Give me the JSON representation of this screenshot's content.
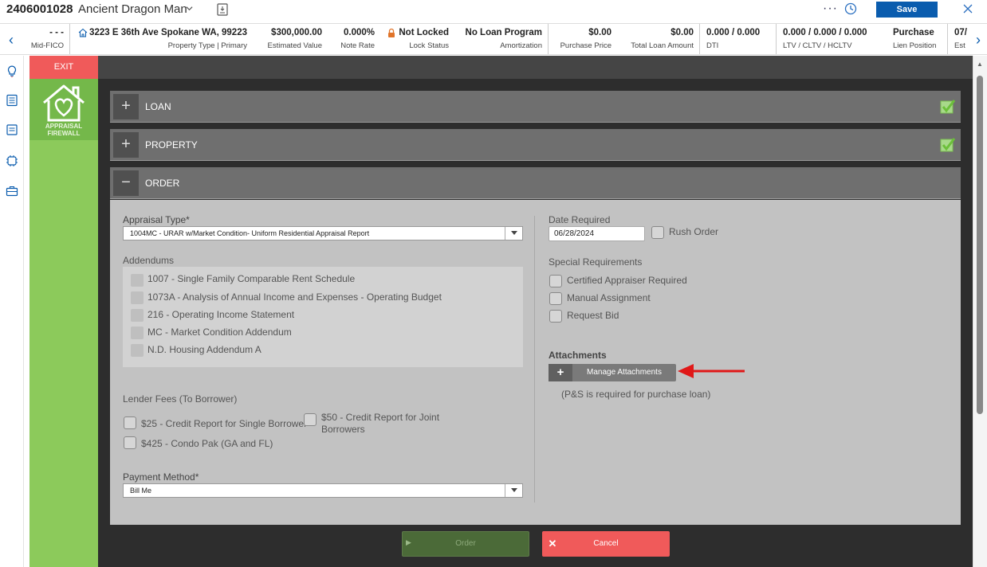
{
  "titlebar": {
    "loan_number": "2406001028",
    "borrower_name": "Ancient Dragon Man",
    "more": "···",
    "save_label": "Save"
  },
  "summary": {
    "items": [
      {
        "value": "- - -",
        "label": "Mid-FICO"
      },
      {
        "value": "3223 E 36th Ave Spokane WA, 99223",
        "label": "Property Type | Primary"
      },
      {
        "value": "$300,000.00",
        "label": "Estimated Value"
      },
      {
        "value": "0.000%",
        "label": "Note Rate"
      },
      {
        "value": "Not Locked",
        "label": "Lock Status"
      },
      {
        "value": "No Loan Program",
        "label": "Amortization"
      },
      {
        "value": "$0.00",
        "label": "Purchase Price"
      },
      {
        "value": "$0.00",
        "label": "Total Loan Amount"
      },
      {
        "value": "0.000 / 0.000",
        "label": "DTI"
      },
      {
        "value": "0.000 / 0.000 / 0.000",
        "label": "LTV / CLTV / HCLTV"
      },
      {
        "value": "Purchase",
        "label": "Lien Position"
      },
      {
        "value": "07/",
        "label": "Est"
      }
    ]
  },
  "sidebar": {
    "exit_label": "EXIT",
    "logo_line1": "APPRAISAL",
    "logo_line2": "FIREWALL"
  },
  "sections": {
    "loan": "LOAN",
    "property": "PROPERTY",
    "order": "ORDER"
  },
  "form": {
    "appraisal_type_label": "Appraisal Type*",
    "appraisal_type_value": "1004MC - URAR w/Market Condition- Uniform Residential Appraisal Report",
    "addendums_label": "Addendums",
    "addendums": [
      "1007 - Single Family Comparable Rent Schedule",
      "1073A - Analysis of Annual Income and Expenses - Operating Budget",
      "216 - Operating Income Statement",
      "MC - Market Condition Addendum",
      "N.D. Housing Addendum A"
    ],
    "lender_fees_label": "Lender Fees (To Borrower)",
    "fee_credit_single": "$25 - Credit Report for Single Borrower",
    "fee_credit_joint_1": "$50 - Credit Report for Joint",
    "fee_credit_joint_2": "Borrowers",
    "fee_condo": "$425 - Condo Pak (GA and FL)",
    "payment_method_label": "Payment Method*",
    "payment_method_value": "Bill Me",
    "date_required_label": "Date Required",
    "date_required_value": "06/28/2024",
    "rush_order_label": "Rush Order",
    "special_requirements_label": "Special Requirements",
    "special_requirements": [
      "Certified Appraiser Required",
      "Manual Assignment",
      "Request Bid"
    ],
    "attachments_label": "Attachments",
    "manage_attachments_label": "Manage Attachments",
    "attachments_note": "(P&S is required for purchase loan)"
  },
  "actions": {
    "order_label": "Order",
    "cancel_label": "Cancel"
  },
  "colors": {
    "brand_blue": "#0a5cae",
    "green_side": "#8cca5b",
    "cancel_red": "#f05a5a",
    "check_green": "#8cd05a"
  }
}
